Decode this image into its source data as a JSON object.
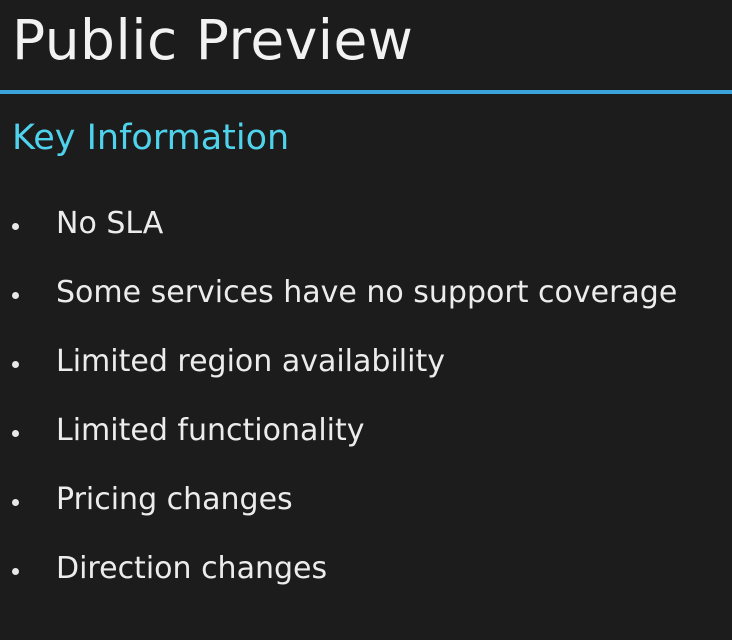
{
  "slide": {
    "title": "Public Preview",
    "subtitle": "Key Information",
    "bullets": [
      "No SLA",
      "Some services have no support coverage",
      "Limited region availability",
      "Limited functionality",
      "Pricing changes",
      "Direction changes"
    ]
  },
  "colors": {
    "background": "#1c1c1c",
    "title": "#f2f2f2",
    "accent_rule": "#3aa3d9",
    "subtitle": "#4fd2ec",
    "body_text": "#ececec"
  }
}
